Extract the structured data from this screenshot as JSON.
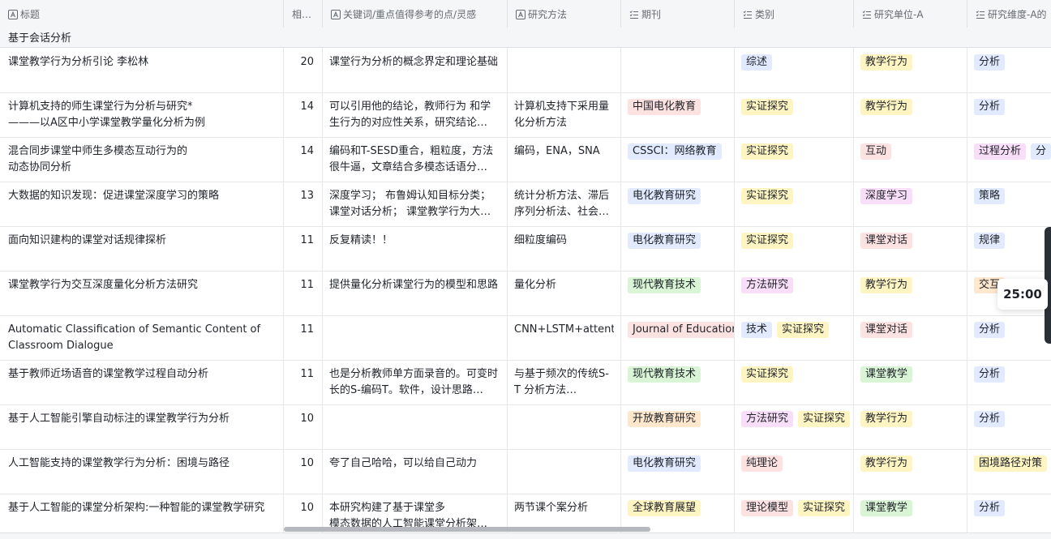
{
  "columns": [
    {
      "label": "标题",
      "icon": "text-field-icon"
    },
    {
      "label": "相…",
      "icon": ""
    },
    {
      "label": "关键词/重点值得参考的点/灵感",
      "icon": "text-field-icon"
    },
    {
      "label": "研究方法",
      "icon": "text-field-icon"
    },
    {
      "label": "期刊",
      "icon": "multi-select-icon"
    },
    {
      "label": "类别",
      "icon": "multi-select-icon"
    },
    {
      "label": "研究单位-A",
      "icon": "multi-select-icon"
    },
    {
      "label": "研究维度-A的",
      "icon": "multi-select-icon"
    }
  ],
  "group_label": "基于会话分析",
  "tag_colors": {
    "blue": "#e1eaff",
    "orange": "#fee7cd",
    "yellow": "#fff5c2",
    "red": "#fde2e2",
    "green": "#d9f5d6",
    "purple": "#f8def8",
    "gray": "#eff0f1"
  },
  "rows": [
    {
      "title": "课堂教学行为分析引论 李松林",
      "cite": "20",
      "key": "课堂行为分析的概念界定和理论基础",
      "method": "",
      "journal": [],
      "type": [
        {
          "t": "综述",
          "c": "blue"
        }
      ],
      "unit": [
        {
          "t": "教学行为",
          "c": "yellow"
        }
      ],
      "dim": [
        {
          "t": "分析",
          "c": "blue"
        }
      ]
    },
    {
      "title": "计算机支持的师生课堂行为分析与研究*\n———以A区中小学课堂教学量化分析为例",
      "cite": "14",
      "key": "可以引用他的结论，教师行为 和学生行为的对应性关系，研究结论…",
      "method": "计算机支持下采用量化分析方法",
      "journal": [
        {
          "t": "中国电化教育",
          "c": "red"
        }
      ],
      "type": [
        {
          "t": "实证探究",
          "c": "yellow"
        }
      ],
      "unit": [
        {
          "t": "教学行为",
          "c": "yellow"
        }
      ],
      "dim": [
        {
          "t": "分析",
          "c": "blue"
        }
      ]
    },
    {
      "title": "混合同步课堂中师生多模态互动行为的\n动态协同分析",
      "cite": "14",
      "key": "编码和T-SESD重合，粗粒度，方法很牛逼，文章结合多模态话语分…",
      "method": "编码，ENA，SNA",
      "journal": [
        {
          "t": "CSSCI：网络教育",
          "c": "blue"
        }
      ],
      "type": [
        {
          "t": "实证探究",
          "c": "yellow"
        }
      ],
      "unit": [
        {
          "t": "互动",
          "c": "red"
        }
      ],
      "dim": [
        {
          "t": "过程分析",
          "c": "purple"
        },
        {
          "t": "分",
          "c": "blue"
        }
      ]
    },
    {
      "title": "大数据的知识发现：促进课堂深度学习的策略",
      "cite": "13",
      "key": "深度学习； 布鲁姆认知目标分类； 课堂对话分析； 课堂教学行为大…",
      "method": "统计分析方法、滞后序列分析法、社会…",
      "journal": [
        {
          "t": "电化教育研究",
          "c": "blue"
        }
      ],
      "type": [
        {
          "t": "实证探究",
          "c": "yellow"
        }
      ],
      "unit": [
        {
          "t": "深度学习",
          "c": "purple"
        }
      ],
      "dim": [
        {
          "t": "策略",
          "c": "blue"
        }
      ]
    },
    {
      "title": "面向知识建构的课堂对话规律探析",
      "cite": "11",
      "key": "反复精读！！",
      "method": "细粒度编码",
      "journal": [
        {
          "t": "电化教育研究",
          "c": "blue"
        }
      ],
      "type": [
        {
          "t": "实证探究",
          "c": "yellow"
        }
      ],
      "unit": [
        {
          "t": "课堂对话",
          "c": "red"
        }
      ],
      "dim": [
        {
          "t": "规律",
          "c": "blue"
        }
      ]
    },
    {
      "title": "课堂教学行为交互深度量化分析方法研究",
      "cite": "11",
      "key": "提供量化分析课堂行为的模型和思路",
      "method": "量化分析",
      "journal": [
        {
          "t": "现代教育技术",
          "c": "green"
        }
      ],
      "type": [
        {
          "t": "方法研究",
          "c": "purple"
        }
      ],
      "unit": [
        {
          "t": "教学行为",
          "c": "yellow"
        }
      ],
      "dim": [
        {
          "t": "交互",
          "c": "orange"
        }
      ]
    },
    {
      "title": "Automatic Classification of Semantic Content of\nClassroom Dialogue",
      "cite": "11",
      "key": "",
      "method": "CNN+LSTM+attention",
      "journal": [
        {
          "t": "Journal of Educational",
          "c": "red"
        }
      ],
      "type": [
        {
          "t": "技术",
          "c": "blue"
        },
        {
          "t": "实证探究",
          "c": "yellow"
        }
      ],
      "unit": [
        {
          "t": "课堂对话",
          "c": "red"
        }
      ],
      "dim": [
        {
          "t": "分析",
          "c": "blue"
        }
      ]
    },
    {
      "title": "基于教师近场语音的课堂教学过程自动分析",
      "cite": "11",
      "key": "也是分析教师单方面录音的。可变时长的S-编码T。软件，设计思路…",
      "method": "与基于频次的传统S-T 分析方法…",
      "journal": [
        {
          "t": "现代教育技术",
          "c": "green"
        }
      ],
      "type": [
        {
          "t": "实证探究",
          "c": "yellow"
        }
      ],
      "unit": [
        {
          "t": "课堂教学",
          "c": "green"
        }
      ],
      "dim": [
        {
          "t": "分析",
          "c": "blue"
        }
      ]
    },
    {
      "title": "基于人工智能引擎自动标注的课堂教学行为分析",
      "cite": "10",
      "key": "",
      "method": "",
      "journal": [
        {
          "t": "开放教育研究",
          "c": "orange"
        }
      ],
      "type": [
        {
          "t": "方法研究",
          "c": "purple"
        },
        {
          "t": "实证探究",
          "c": "yellow"
        }
      ],
      "unit": [
        {
          "t": "教学行为",
          "c": "yellow"
        }
      ],
      "dim": [
        {
          "t": "分析",
          "c": "blue"
        }
      ]
    },
    {
      "title": "人工智能支持的课堂教学行为分析：困境与路径",
      "cite": "10",
      "key": "夸了自己哈哈，可以给自己动力",
      "method": "",
      "journal": [
        {
          "t": "电化教育研究",
          "c": "blue"
        }
      ],
      "type": [
        {
          "t": "纯理论",
          "c": "red"
        }
      ],
      "unit": [
        {
          "t": "教学行为",
          "c": "yellow"
        }
      ],
      "dim": [
        {
          "t": "困境路径对策",
          "c": "yellow"
        }
      ]
    },
    {
      "title": "基于人工智能的课堂分析架构:一种智能的课堂教学研究",
      "cite": "10",
      "key": "本研究构建了基于课堂多\n模态数据的人工智能课堂分析架…",
      "method": "两节课个案分析",
      "journal": [
        {
          "t": "全球教育展望",
          "c": "yellow"
        }
      ],
      "type": [
        {
          "t": "理论模型",
          "c": "red"
        },
        {
          "t": "实证探究",
          "c": "yellow"
        }
      ],
      "unit": [
        {
          "t": "课堂教学",
          "c": "green"
        }
      ],
      "dim": [
        {
          "t": "分析",
          "c": "blue"
        }
      ]
    }
  ],
  "timer": "25:00"
}
